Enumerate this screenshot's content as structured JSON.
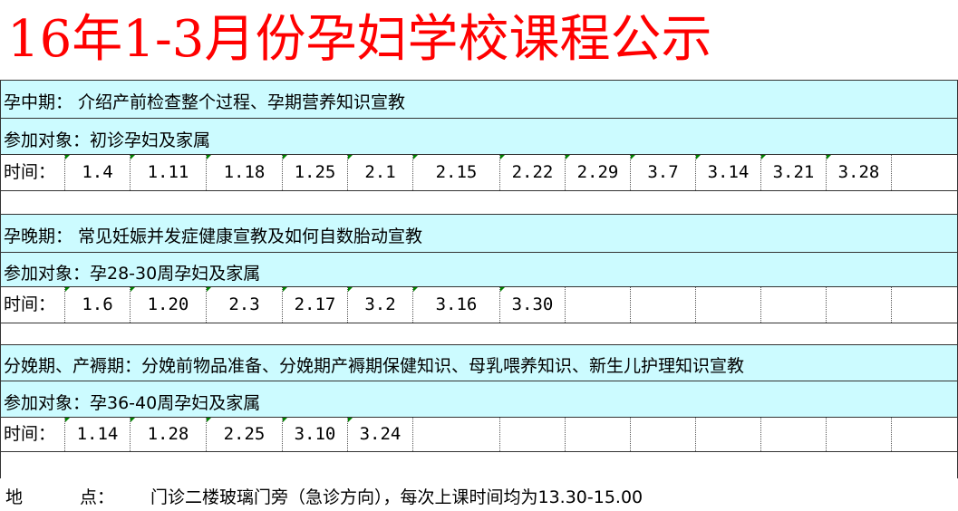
{
  "title": "16年1-3月份孕妇学校课程公示",
  "sections": [
    {
      "topic": "孕中期：  介绍产前检查整个过程、孕期营养知识宣教",
      "audience": "参加对象：初诊孕妇及家属",
      "time_label": "时间：",
      "dates": [
        "1.4",
        "1.11",
        "1.18",
        "1.25",
        "2.1",
        "2.15",
        "2.22",
        "2.29",
        "3.7",
        "3.14",
        "3.21",
        "3.28",
        ""
      ]
    },
    {
      "topic": "孕晚期：   常见妊娠并发症健康宣教及如何自数胎动宣教",
      "audience": "参加对象：孕28-30周孕妇及家属",
      "time_label": "时间：",
      "dates": [
        "1.6",
        "1.20",
        "2.3",
        "2.17",
        "3.2",
        "3.16",
        "3.30",
        "",
        "",
        "",
        "",
        "",
        ""
      ]
    },
    {
      "topic": "分娩期、产褥期：分娩前物品准备、分娩期产褥期保健知识、母乳喂养知识、新生儿护理知识宣教",
      "audience": "参加对象：孕36-40周孕妇及家属",
      "time_label": "时间：",
      "dates": [
        "1.14",
        "1.28",
        "2.25",
        "3.10",
        "3.24",
        "",
        "",
        "",
        "",
        "",
        "",
        "",
        ""
      ]
    }
  ],
  "footer": {
    "label_1": "地",
    "label_2": "点：",
    "text": "门诊二楼玻璃门旁（急诊方向），每次上课时间均为13.30-15.00"
  },
  "colors": {
    "title": "#ff0000",
    "band": "#ccfbff",
    "marker": "#008000"
  }
}
